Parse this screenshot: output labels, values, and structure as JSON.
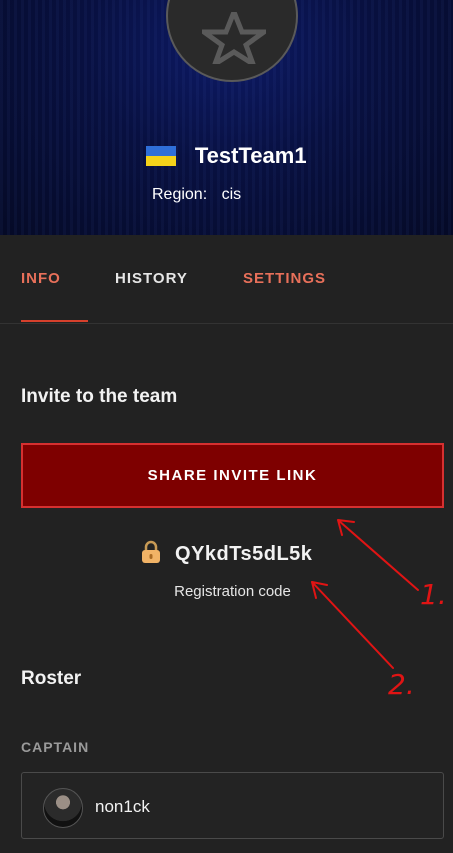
{
  "team": {
    "name": "TestTeam1",
    "region_label": "Region:",
    "region_value": "cis"
  },
  "tabs": [
    {
      "label": "INFO",
      "active": true
    },
    {
      "label": "HISTORY",
      "active": false
    },
    {
      "label": "SETTINGS",
      "active": false
    }
  ],
  "invite": {
    "title": "Invite to the team",
    "button_label": "SHARE INVITE LINK",
    "code": "QYkdTs5dL5k",
    "code_caption": "Registration code"
  },
  "roster": {
    "title": "Roster",
    "captain_label": "CAPTAIN",
    "captain_name": "non1ck"
  },
  "annotations": {
    "mark_1": "1.",
    "mark_2": "2."
  },
  "colors": {
    "accent": "#e8705a",
    "button_bg": "#7e0000",
    "button_border": "#d63030",
    "background": "#222222",
    "hero_bg": "#081040"
  }
}
